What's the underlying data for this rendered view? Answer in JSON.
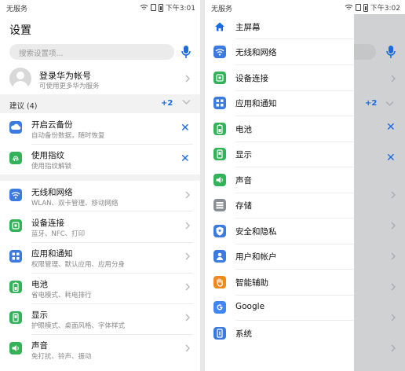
{
  "left_screen": {
    "status": {
      "carrier": "无服务",
      "time": "下午3:01"
    },
    "title": "设置",
    "search": {
      "placeholder": "搜索设置项..."
    },
    "account": {
      "title": "登录华为帐号",
      "subtitle": "可使用更多华为服务"
    },
    "suggestions": {
      "label": "建议 (4)",
      "count": "+2"
    },
    "suggestion_items": [
      {
        "title": "开启云备份",
        "subtitle": "自动备份数据，随时恢复",
        "icon": "cloud-backup-icon"
      },
      {
        "title": "使用指纹",
        "subtitle": "使用指纹解锁",
        "icon": "fingerprint-icon"
      }
    ],
    "settings_items": [
      {
        "title": "无线和网络",
        "subtitle": "WLAN、双卡管理、移动网络",
        "icon": "wifi-icon"
      },
      {
        "title": "设备连接",
        "subtitle": "蓝牙、NFC、打印",
        "icon": "device-connection-icon"
      },
      {
        "title": "应用和通知",
        "subtitle": "权限管理、默认应用、应用分身",
        "icon": "apps-icon"
      },
      {
        "title": "电池",
        "subtitle": "省电模式、耗电排行",
        "icon": "battery-icon"
      },
      {
        "title": "显示",
        "subtitle": "护眼模式、桌面风格、字体样式",
        "icon": "display-icon"
      },
      {
        "title": "声音",
        "subtitle": "免打扰、铃声、振动",
        "icon": "sound-icon"
      }
    ]
  },
  "right_screen": {
    "status": {
      "carrier": "无服务",
      "time": "下午3:02"
    },
    "shade_count": "+2",
    "drawer_items": [
      {
        "label": "主屏幕",
        "icon": "home-icon"
      },
      {
        "label": "无线和网络",
        "icon": "wifi-icon"
      },
      {
        "label": "设备连接",
        "icon": "device-connection-icon"
      },
      {
        "label": "应用和通知",
        "icon": "apps-icon"
      },
      {
        "label": "电池",
        "icon": "battery-icon"
      },
      {
        "label": "显示",
        "icon": "display-icon"
      },
      {
        "label": "声音",
        "icon": "sound-icon"
      },
      {
        "label": "存储",
        "icon": "storage-icon"
      },
      {
        "label": "安全和隐私",
        "icon": "shield-icon"
      },
      {
        "label": "用户和帐户",
        "icon": "user-icon"
      },
      {
        "label": "智能辅助",
        "icon": "hand-icon"
      },
      {
        "label": "Google",
        "icon": "google-icon"
      },
      {
        "label": "系统",
        "icon": "system-icon"
      }
    ]
  },
  "colors": {
    "accent": "#1a6ae0",
    "blue_icon": "#3b7be0",
    "green_icon": "#32b35a",
    "orange_icon": "#f08a1c",
    "gray_icon": "#8a8f96"
  }
}
